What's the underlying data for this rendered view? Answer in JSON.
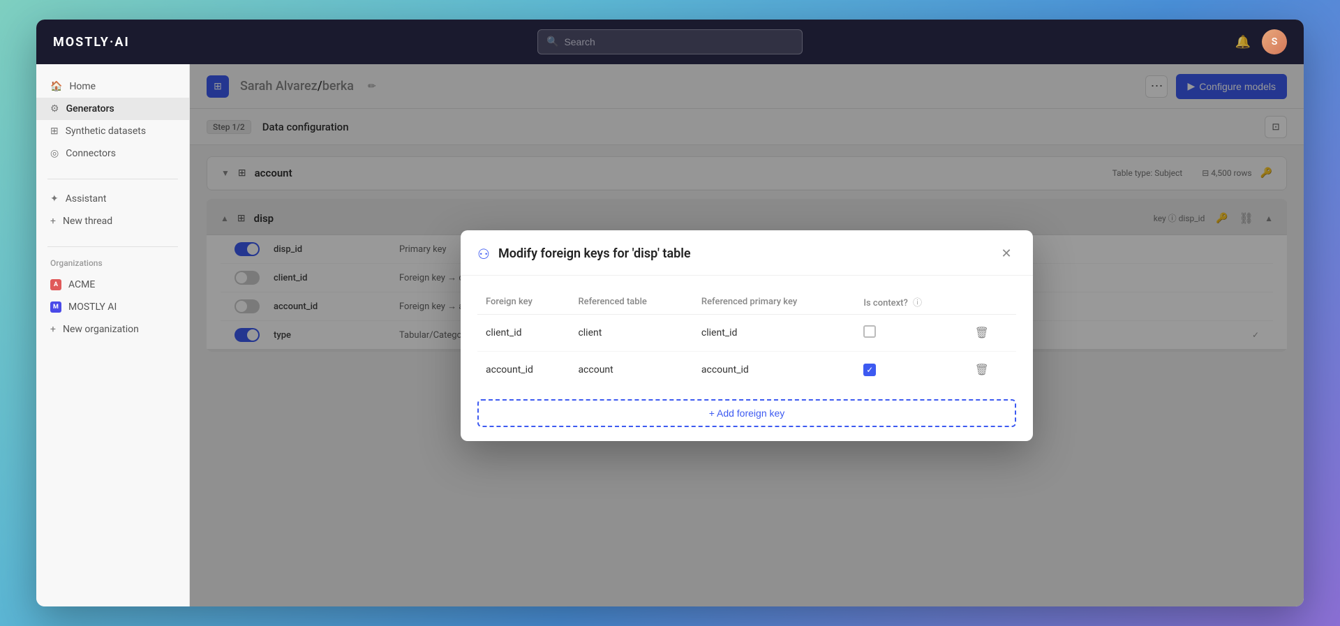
{
  "app": {
    "logo": "MOSTLY·AI"
  },
  "topbar": {
    "search_placeholder": "Search"
  },
  "sidebar": {
    "nav_items": [
      {
        "id": "home",
        "label": "Home",
        "icon": "🏠"
      },
      {
        "id": "generators",
        "label": "Generators",
        "icon": "⚙"
      },
      {
        "id": "synthetic-datasets",
        "label": "Synthetic datasets",
        "icon": "⊞"
      },
      {
        "id": "connectors",
        "label": "Connectors",
        "icon": "◎"
      }
    ],
    "assistant_label": "Assistant",
    "new_thread_label": "New thread",
    "organizations_label": "Organizations",
    "org_items": [
      {
        "id": "acme",
        "label": "ACME",
        "color": "red",
        "initials": "A"
      },
      {
        "id": "mostly-ai",
        "label": "MOSTLY AI",
        "color": "blue",
        "initials": "M"
      }
    ],
    "new_org_label": "New organization"
  },
  "header": {
    "breadcrumb_user": "Sarah Alvarez",
    "breadcrumb_separator": "/",
    "breadcrumb_project": "berka",
    "more_label": "⋯",
    "configure_btn": "Configure models"
  },
  "step": {
    "badge": "Step 1/2",
    "title": "Data configuration"
  },
  "table_account": {
    "name": "account",
    "type": "Table type: Subject",
    "rows": "4,500 rows",
    "chevron_open": "▼"
  },
  "modal": {
    "title": "Modify foreign keys for 'disp' table",
    "icon": "⚇",
    "columns": {
      "foreign_key": "Foreign key",
      "referenced_table": "Referenced table",
      "referenced_primary_key": "Referenced primary key",
      "is_context": "Is context?"
    },
    "rows": [
      {
        "foreign_key": "client_id",
        "referenced_table": "client",
        "referenced_primary_key": "client_id",
        "is_context": false
      },
      {
        "foreign_key": "account_id",
        "referenced_table": "account",
        "referenced_primary_key": "account_id",
        "is_context": true
      }
    ],
    "add_btn": "+ Add foreign key",
    "close_icon": "✕"
  },
  "disp_table": {
    "rows": [
      {
        "id": "disp_id",
        "type": "Primary key",
        "toggle": "on"
      },
      {
        "id": "client_id",
        "type": "Foreign key → client",
        "toggle": "off"
      },
      {
        "id": "account_id",
        "type": "Foreign key → account",
        "toggle": "off"
      },
      {
        "id": "type",
        "type": "Tabular/Categorical",
        "toggle": "on"
      }
    ],
    "col_extra_label": "disp_id"
  }
}
